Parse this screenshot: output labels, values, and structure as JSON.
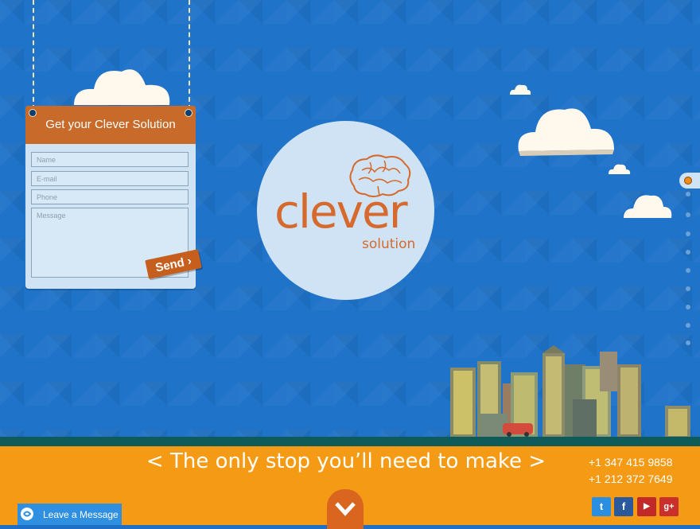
{
  "form": {
    "title": "Get your Clever Solution",
    "name_placeholder": "Name",
    "email_placeholder": "E-mail",
    "phone_placeholder": "Phone",
    "message_placeholder": "Message",
    "send_label": "Send"
  },
  "logo": {
    "main": "clever",
    "sub": "solution"
  },
  "side_nav": {
    "items": 10,
    "active_index": 0
  },
  "footer": {
    "tagline": "< The only stop you’ll need to make >",
    "phone_1": "+1 347 415 9858",
    "phone_2": "+1 212 372 7649",
    "social": [
      {
        "name": "twitter-icon",
        "glyph": "t",
        "color": "#2a8fe0"
      },
      {
        "name": "facebook-icon",
        "glyph": "f",
        "color": "#2a5a9c"
      },
      {
        "name": "youtube-icon",
        "glyph": "▶",
        "color": "#c22a2a"
      },
      {
        "name": "google-plus-icon",
        "glyph": "g+",
        "color": "#c9302c"
      }
    ],
    "leave_message": "Leave a Message"
  },
  "colors": {
    "sky": "#1f73c9",
    "accent_orange": "#f49a14",
    "form_header": "#c76a2a",
    "logo_orange": "#d6692d"
  }
}
